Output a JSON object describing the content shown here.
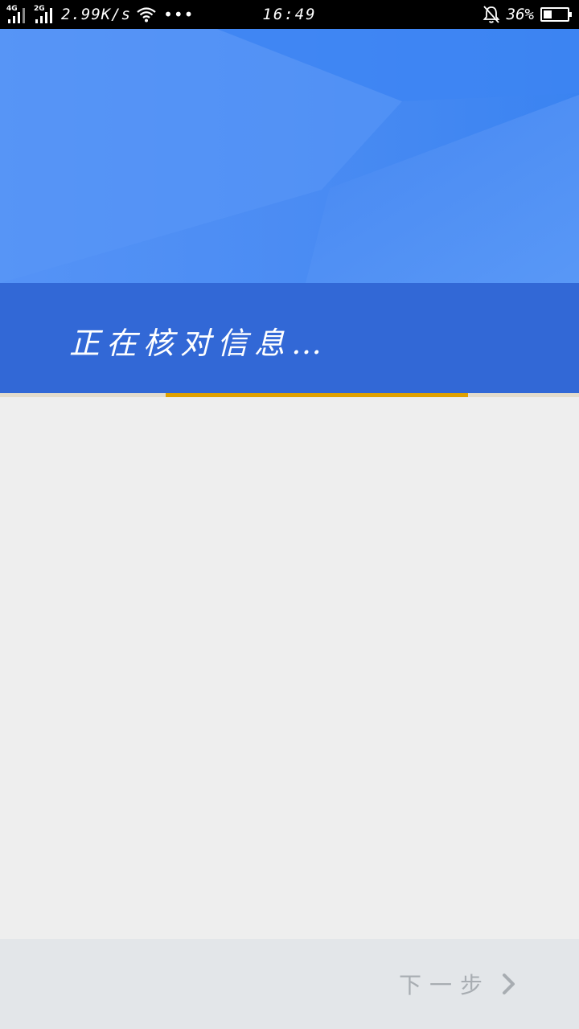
{
  "status_bar": {
    "network_1": "4G",
    "network_2": "2G",
    "speed": "2.99K/s",
    "more_dots": "•••",
    "time": "16:49",
    "battery_percent_text": "36%",
    "battery_level": 0.36,
    "icons": [
      "signal-icon",
      "wifi-icon",
      "bell-muted-icon",
      "battery-icon"
    ]
  },
  "banner": {
    "message": "正在核对信息…",
    "colors": {
      "sky": "#3f86f2",
      "strip": "#3268d6",
      "text": "#ffffff"
    }
  },
  "progress": {
    "start": 0.286,
    "end": 0.808,
    "color": "#e0a100"
  },
  "bottom_bar": {
    "next_label": "下一步",
    "next_icon": "chevron-right-icon"
  }
}
